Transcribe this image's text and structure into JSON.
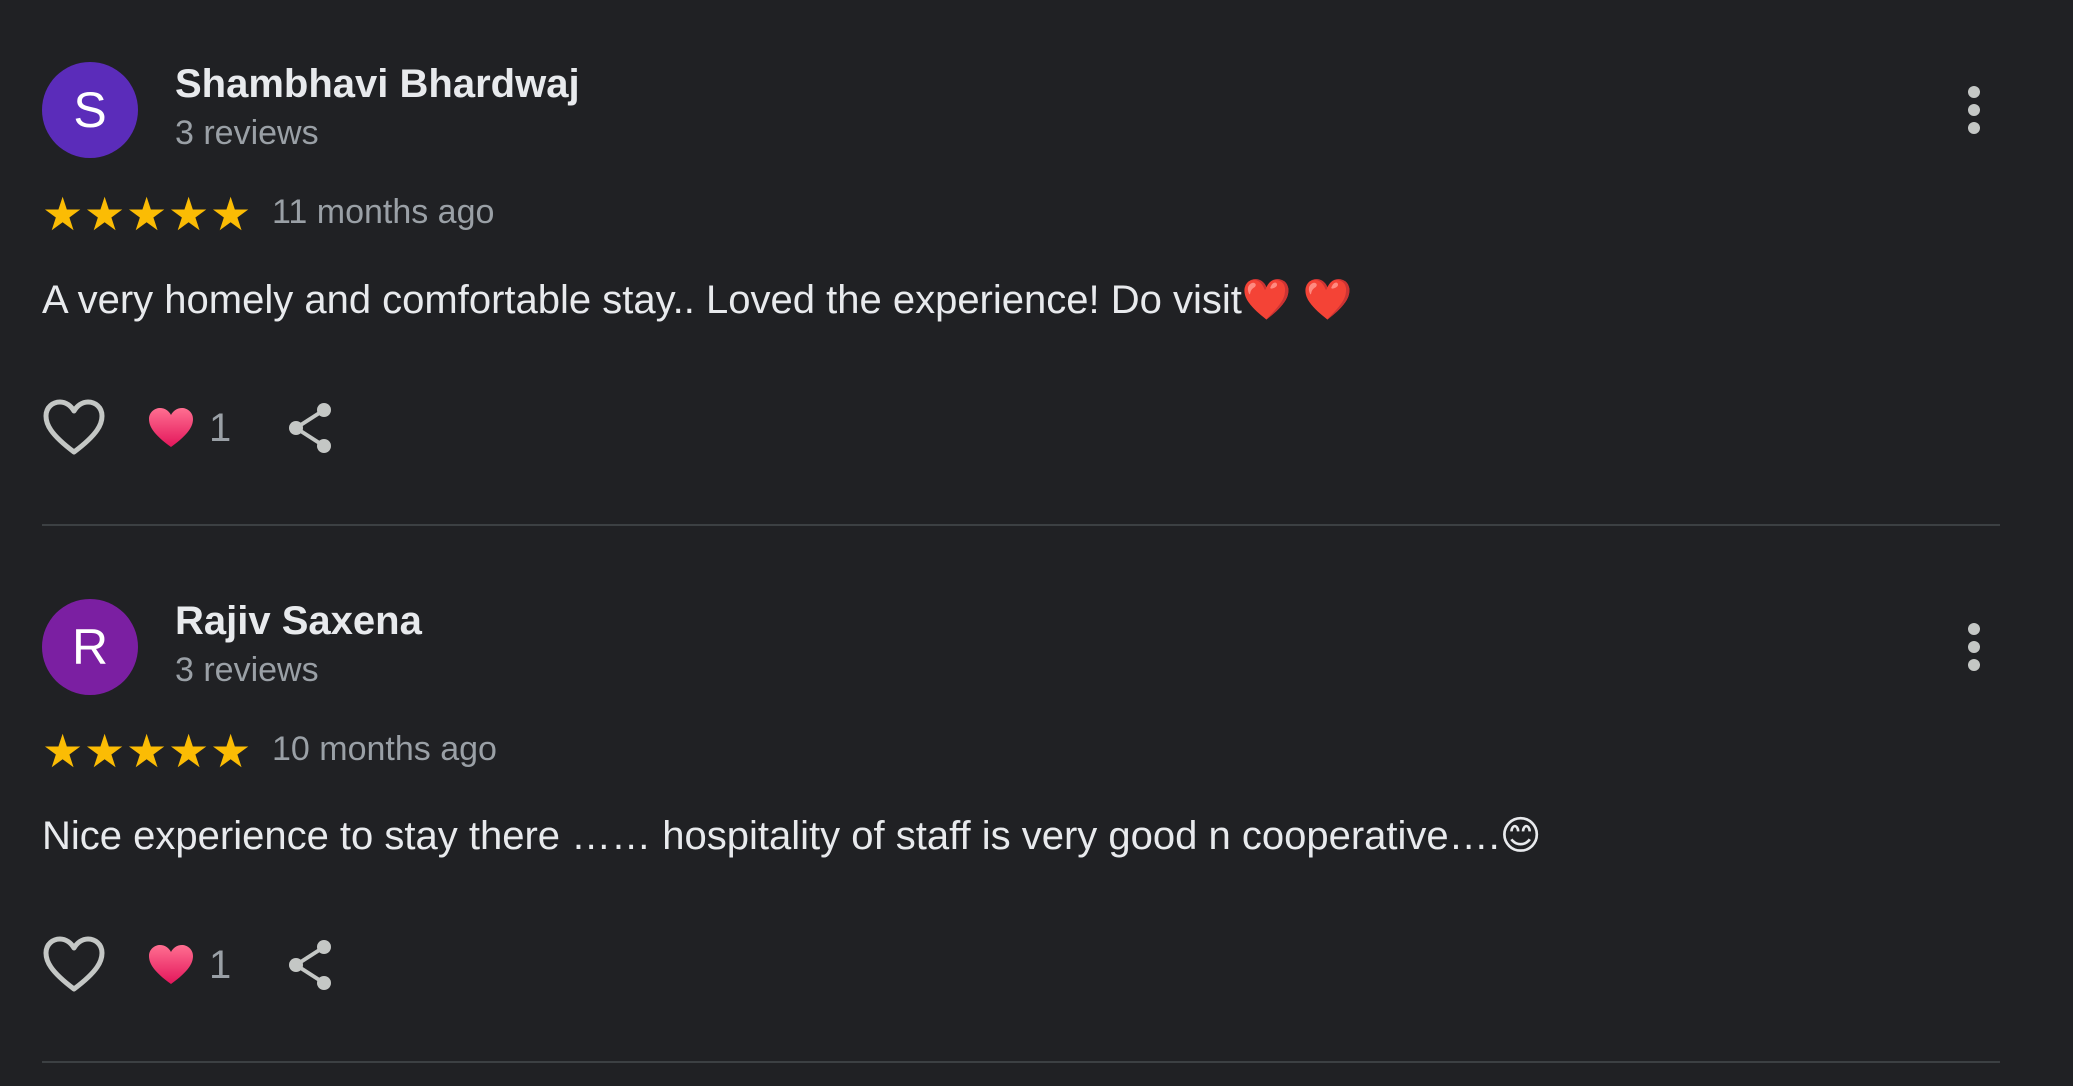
{
  "reviews": [
    {
      "initial": "S",
      "avatar_color": "#5b2cba",
      "name": "Shambhavi Bhardwaj",
      "review_count": "3 reviews",
      "rating": 5,
      "time": "11 months ago",
      "text": "A very homely and comfortable stay.. Loved the experience! Do visit",
      "text_emoji": "❤️ ❤️",
      "reaction_count": "1"
    },
    {
      "initial": "R",
      "avatar_color": "#7b1fa2",
      "name": "Rajiv Saxena",
      "review_count": "3 reviews",
      "rating": 5,
      "time": "10 months ago",
      "text": "Nice experience to stay there …… hospitality of staff is very good n cooperative….",
      "text_emoji": "😊",
      "reaction_count": "1"
    }
  ],
  "icons": {
    "star": "star-icon",
    "like": "heart-outline-icon",
    "reaction": "heart-reaction-icon",
    "share": "share-icon",
    "menu": "more-vert-icon"
  },
  "colors": {
    "background": "#202124",
    "star": "#fbbc04",
    "heart": "#f0437a"
  }
}
